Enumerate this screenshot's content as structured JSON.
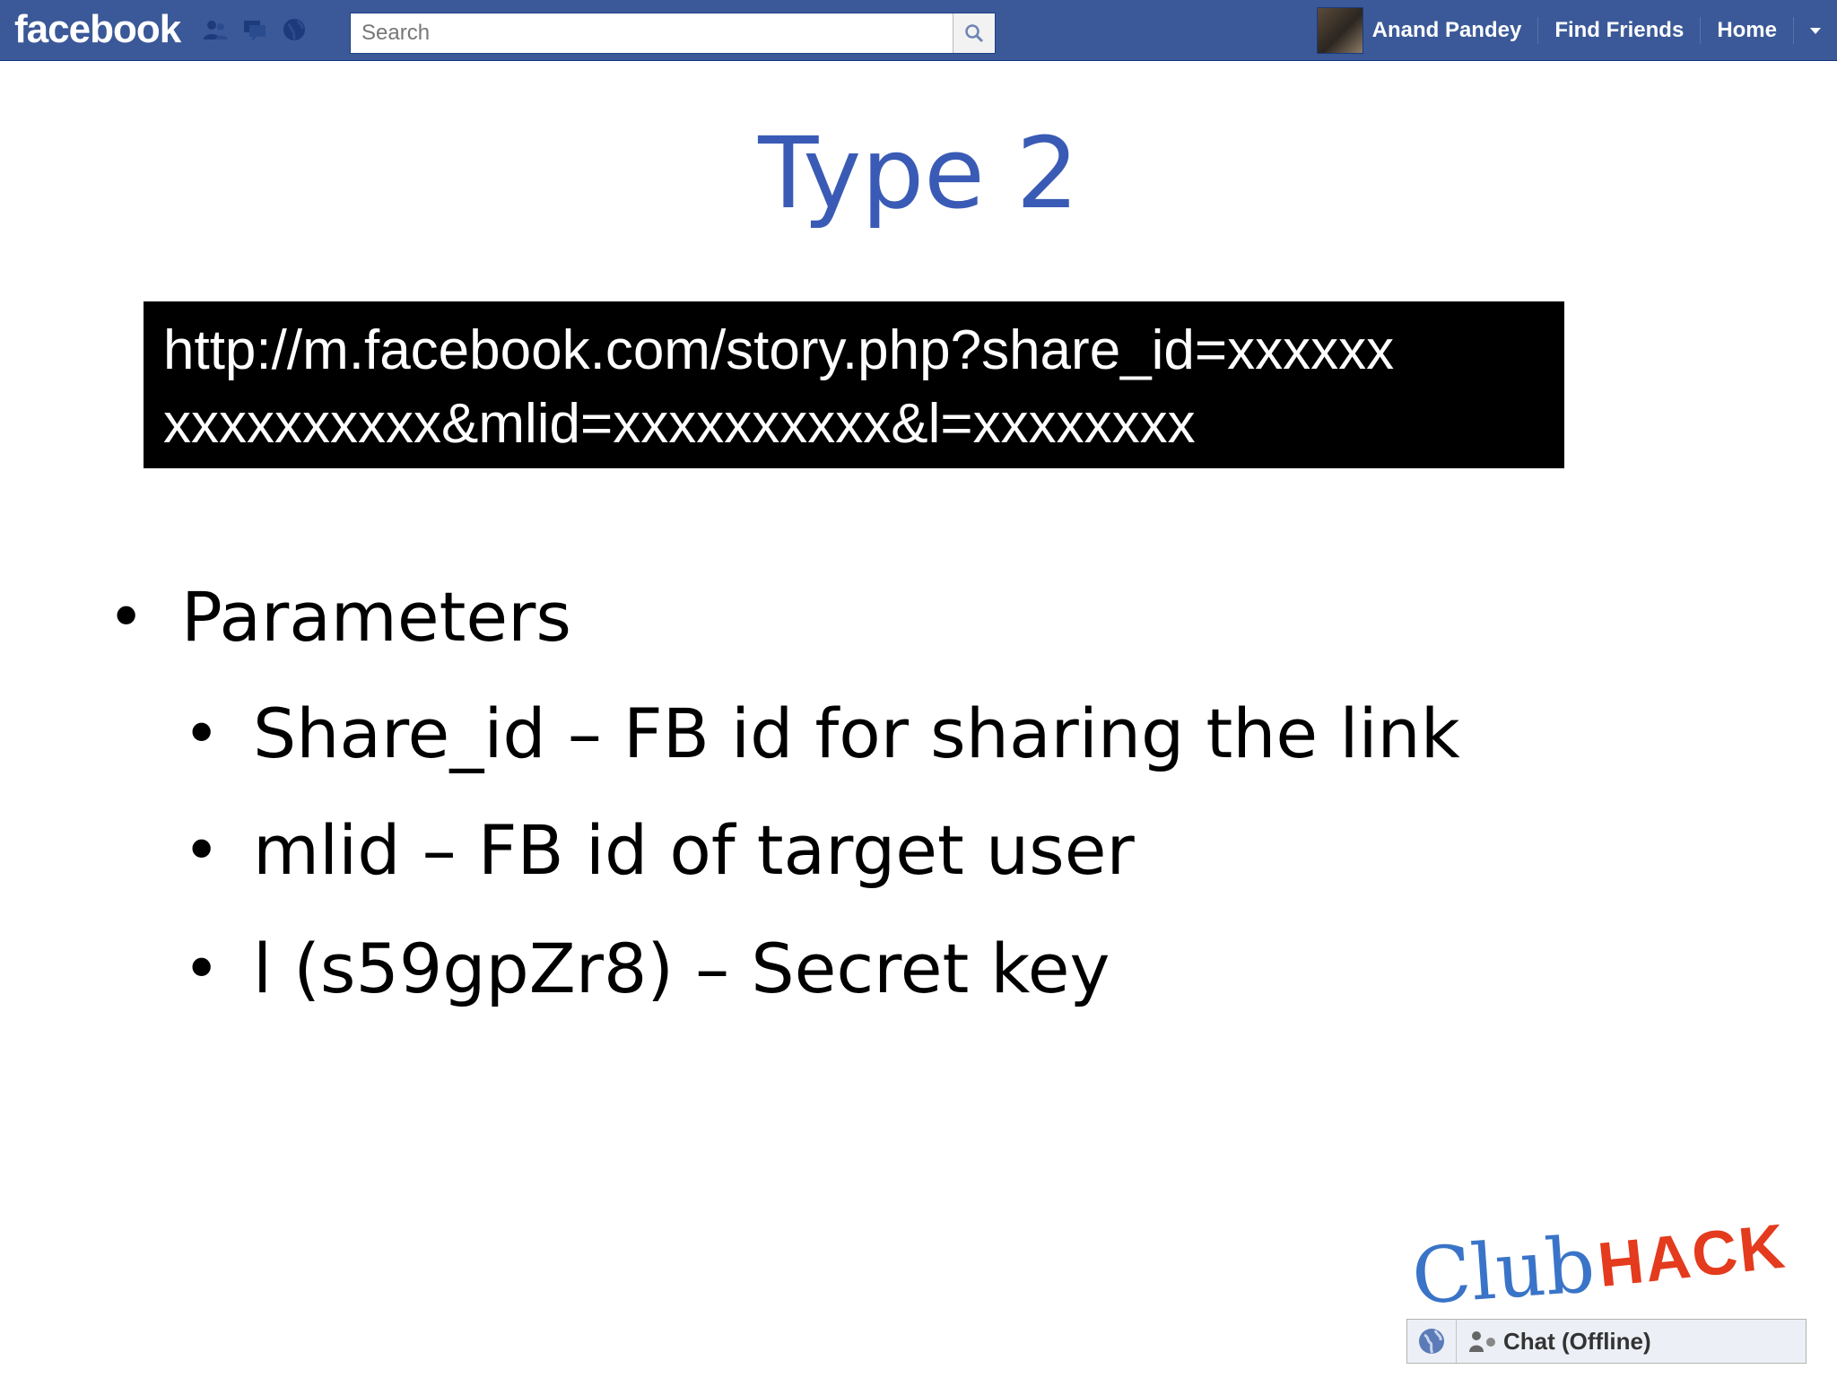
{
  "topbar": {
    "logo": "facebook",
    "search_placeholder": "Search",
    "user_name": "Anand Pandey",
    "links": [
      "Find Friends",
      "Home"
    ],
    "jewels": [
      "friend-requests-icon",
      "messages-icon",
      "notifications-globe-icon"
    ]
  },
  "slide": {
    "title": "Type 2",
    "url": "http://m.facebook.com/story.php?share_id=xxxxxx xxxxxxxxxx&mlid=xxxxxxxxxx&l=xxxxxxxx",
    "url_lines": [
      "http://m.facebook.com/story.php?share_id=xxxxxx",
      "xxxxxxxxxx&mlid=xxxxxxxxxx&l=xxxxxxxx"
    ],
    "bullet_main": "Parameters",
    "sub_bullets": [
      "Share_id – FB id for sharing the link",
      "mlid – FB id of target user",
      "l (s59gpZr8) – Secret key"
    ]
  },
  "branding": {
    "club": "Club",
    "hack": "HACK"
  },
  "chat": {
    "label": "Chat (Offline)"
  },
  "colors": {
    "fb_blue": "#3b5998",
    "title_blue": "#3a5bb5",
    "club_blue": "#3a74c8",
    "hack_red": "#e43a1d"
  }
}
